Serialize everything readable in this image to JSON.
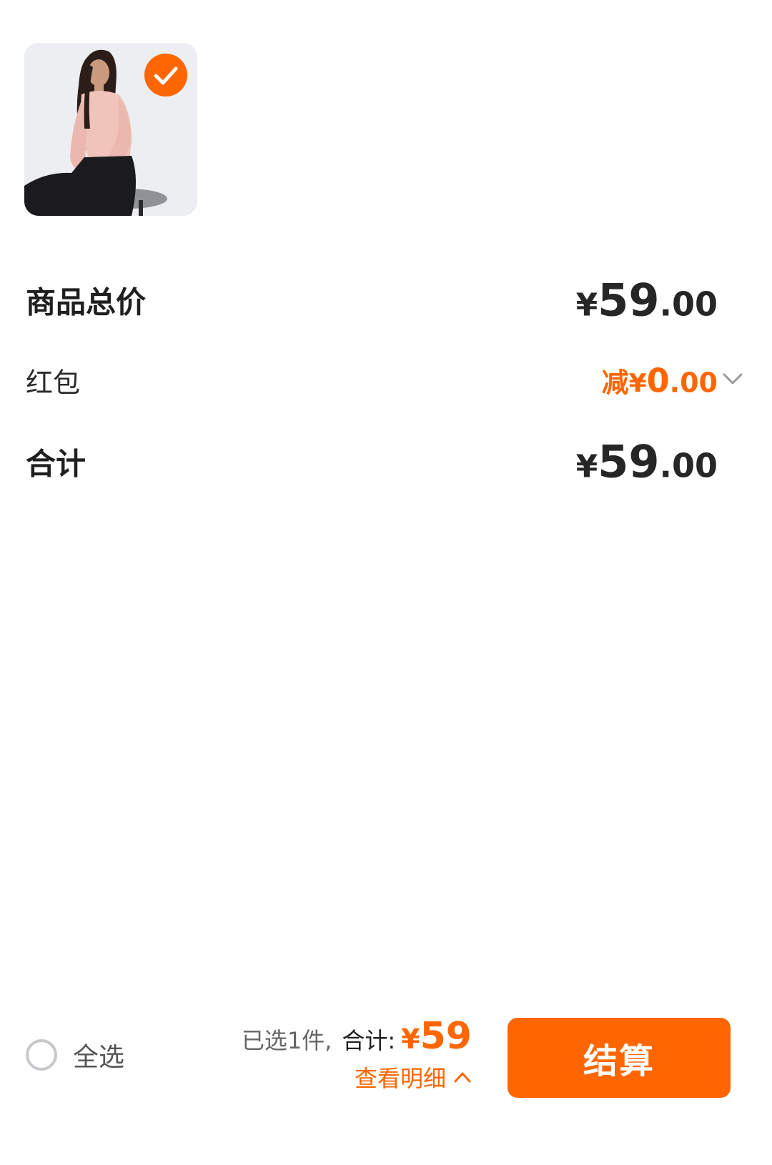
{
  "colors": {
    "accent": "#ff6600",
    "text_dark": "#222222",
    "text_muted": "#666666",
    "thumb_bg": "#eceef1"
  },
  "product": {
    "image_icon": "product-photo-woman-pink-sweater",
    "selected": true,
    "check_icon": "check-icon"
  },
  "price_rows": {
    "goods_total": {
      "label": "商品总价",
      "currency": "¥",
      "integer": "59",
      "decimal": ".00"
    },
    "red_packet": {
      "label": "红包",
      "prefix": "减",
      "currency": "¥",
      "integer": "0",
      "decimal": ".00",
      "icon": "chevron-down-icon"
    },
    "total": {
      "label": "合计",
      "currency": "¥",
      "integer": "59",
      "decimal": ".00"
    }
  },
  "bottom_bar": {
    "select_all_label": "全选",
    "select_all_checked": false,
    "selected_count": "已选1件,",
    "total_label": "合计:",
    "total_currency": "¥",
    "total_amount": "59",
    "view_detail_label": "查看明细",
    "view_detail_icon": "chevron-up-icon",
    "checkout_label": "结算"
  }
}
